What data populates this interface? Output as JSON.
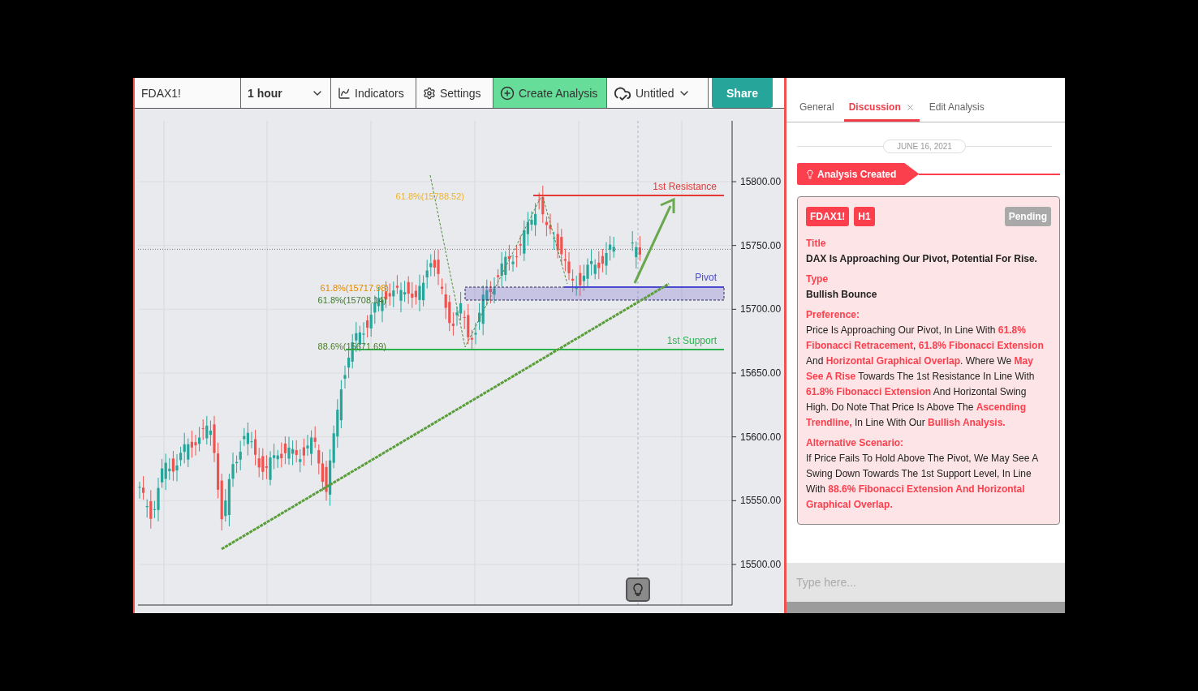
{
  "toolbar": {
    "symbol": "FDAX1!",
    "interval": "1 hour",
    "indicators": "Indicators",
    "settings": "Settings",
    "create": "Create Analysis",
    "layout": "Untitled",
    "share": "Share"
  },
  "chart": {
    "price_labels": [
      "15800.00",
      "15750.00",
      "15700.00",
      "15650.00",
      "15600.00",
      "15550.00",
      "15500.00"
    ],
    "annotations": [
      {
        "kind": "resistance",
        "label": "1st Resistance",
        "levels": [
          "61.8%(15788.52)"
        ]
      },
      {
        "kind": "pivot",
        "label": "Pivot",
        "levels": [
          "61.8%(15717.98)",
          "61.8%(15708.14)"
        ]
      },
      {
        "kind": "support",
        "label": "1st Support",
        "levels": [
          "88.6%(15671.69)"
        ]
      }
    ]
  },
  "panel": {
    "tabs": [
      {
        "label": "General",
        "selected": false,
        "closable": false
      },
      {
        "label": "Discussion",
        "selected": true,
        "closable": true
      },
      {
        "label": "Edit Analysis",
        "selected": false,
        "closable": false
      }
    ],
    "date": "JUNE 16, 2021",
    "event": "Analysis Created",
    "card": {
      "symbol": "FDAX1!",
      "timeframe": "H1",
      "status": "Pending",
      "sections": [
        {
          "kind": "strong",
          "heading": "Title",
          "body": "DAX Is Approaching Our Pivot, Potential For Rise."
        },
        {
          "kind": "strong",
          "heading": "Type",
          "body": "Bullish Bounce"
        },
        {
          "kind": "text",
          "heading": "Preference:",
          "body": "Price Is Approaching Our Pivot, In Line With **61.8% Fibonacci Retracement**, **61.8% Fibonacci Extension** And **Horizontal Graphical Overlap**. Where We **May See A Rise** Towards The 1st Resistance In Line With **61.8% Fibonacci Extension** And Horizontal Swing High. Do Note That Price Is Above The **Ascending Trendline,** In Line With Our **Bullish Analysis.**"
        },
        {
          "kind": "text",
          "heading": "Alternative Scenario:",
          "body": "If Price Fails To Hold Above The Pivot, We May See A Swing Down Towards The 1st Support Level, In Line With **88.6% Fibonacci Extension And Horizontal Graphical Overlap.**"
        }
      ]
    },
    "composer": {
      "placeholder": "Type here..."
    }
  }
}
